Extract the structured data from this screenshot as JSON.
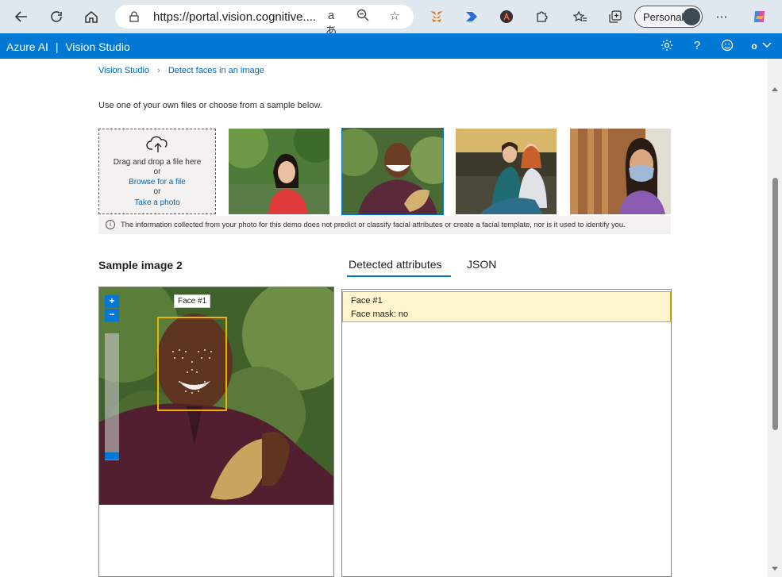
{
  "browser": {
    "url": "https://portal.vision.cognitive....",
    "profile_label": "Personal"
  },
  "header": {
    "brand": "Azure AI",
    "separator": "|",
    "product": "Vision Studio",
    "account_initial": "o"
  },
  "breadcrumb": {
    "items": [
      "Vision Studio",
      "Detect faces in an image"
    ]
  },
  "instructions": "Use one of your own files or choose from a sample below.",
  "upload": {
    "drag_text": "Drag and drop a file here",
    "or1": "or",
    "browse_link": "Browse for a file",
    "or2": "or",
    "photo_link": "Take a photo"
  },
  "notice": "The information collected from your photo for this demo does not predict or classify facial attributes or create a facial template, nor is it used to identify you.",
  "preview": {
    "title": "Sample image 2",
    "face_label": "Face #1",
    "zoom_in": "+",
    "zoom_out": "−"
  },
  "tabs": [
    "Detected attributes",
    "JSON"
  ],
  "results": {
    "face": "Face #1",
    "mask": "Face mask: no"
  },
  "colors": {
    "accent": "#0078d4",
    "highlight_bg": "#fff4ce",
    "face_box": "#f0b400"
  }
}
